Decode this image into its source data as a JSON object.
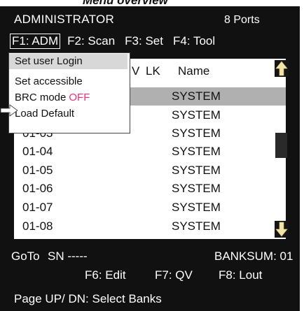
{
  "doc": {
    "heading_partial": "Menu overview"
  },
  "header": {
    "title": "ADMINISTRATOR",
    "ports": "8 Ports"
  },
  "menubar": {
    "f1": "F1: ADM",
    "f2": "F2: Scan",
    "f3": "F3: Set",
    "f4": "F4: Tool"
  },
  "list": {
    "col_v_partial": "V",
    "col_lk": "LK",
    "col_name": "Name",
    "rows": [
      {
        "port": "",
        "name": "SYSTEM"
      },
      {
        "port": "",
        "name": "SYSTEM"
      },
      {
        "port": "01-03",
        "name": "SYSTEM"
      },
      {
        "port": "01-04",
        "name": "SYSTEM"
      },
      {
        "port": "01-05",
        "name": "SYSTEM"
      },
      {
        "port": "01-06",
        "name": "SYSTEM"
      },
      {
        "port": "01-07",
        "name": "SYSTEM"
      },
      {
        "port": "01-08",
        "name": "SYSTEM"
      }
    ]
  },
  "popup": {
    "items": [
      "Set user Login",
      "Set accessible",
      "BRC mode",
      "Load Default"
    ],
    "brc_value": "OFF"
  },
  "footer": {
    "goto": "GoTo",
    "sn": "SN -----",
    "banksum": "BANKSUM: 01",
    "f6": "F6: Edit",
    "f7": "F7: QV",
    "f8": "F8: Lout",
    "page": "Page UP/ DN: Select Banks"
  },
  "colors": {
    "screen_bg": "#111111",
    "selected_row": "#b0b0b0",
    "off_accent": "#e8307a",
    "arrow": "#f2e3a8"
  },
  "icons": [
    "pointer-arrow-icon",
    "scroll-up-arrow-icon",
    "scroll-down-arrow-icon"
  ]
}
